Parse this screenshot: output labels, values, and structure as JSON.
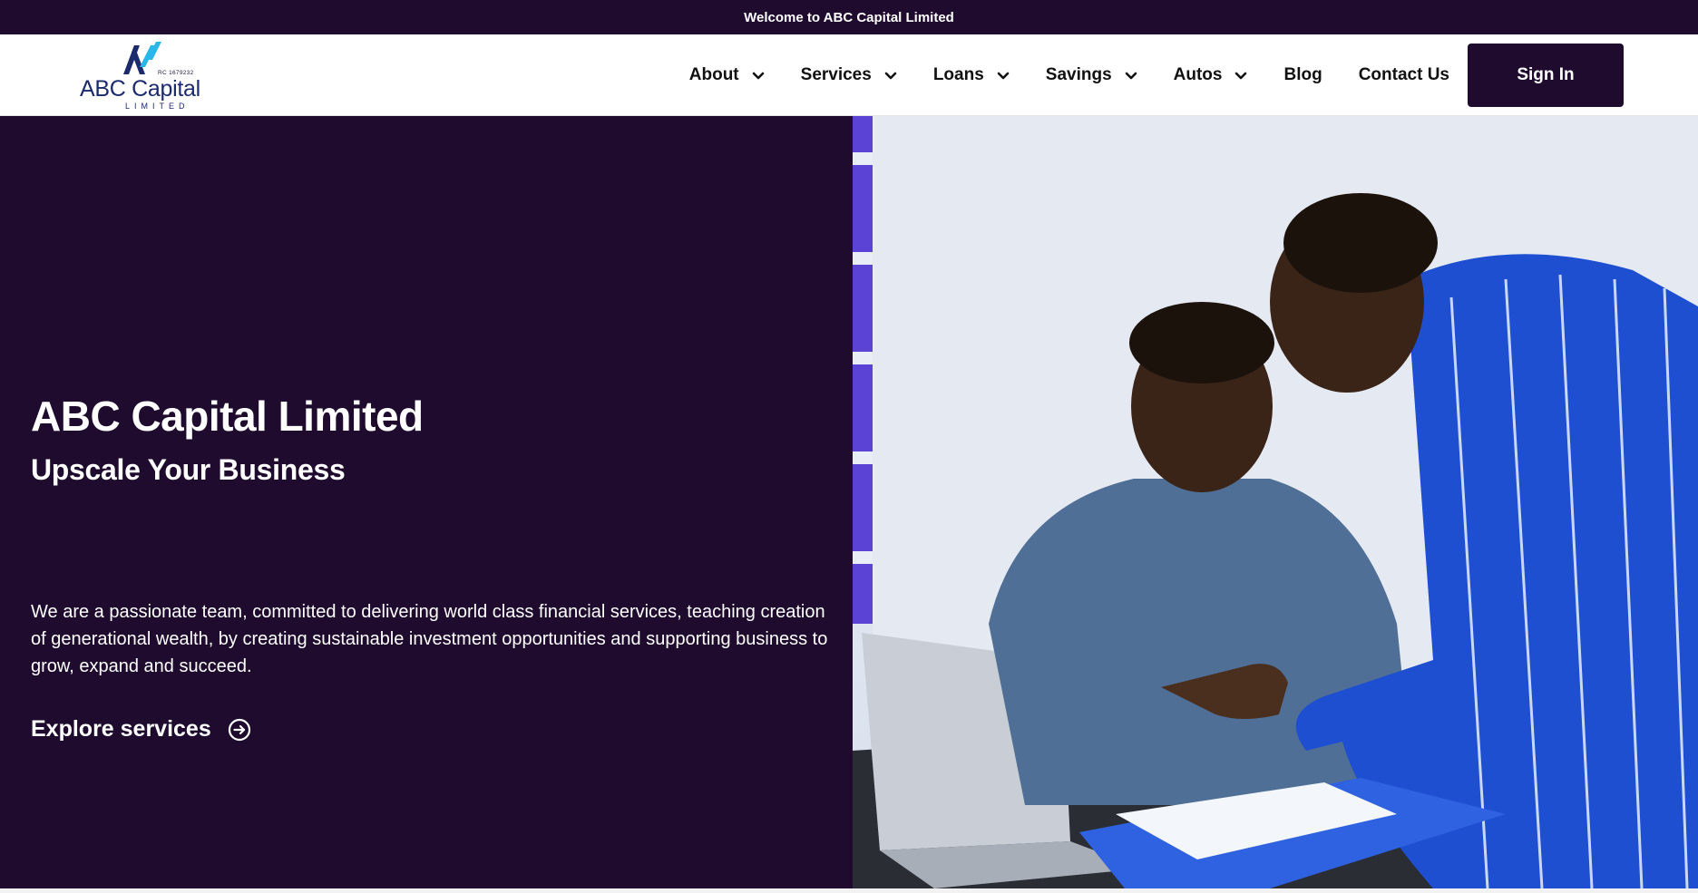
{
  "topbar": {
    "welcome": "Welcome to ABC Capital Limited"
  },
  "logo": {
    "registration": "RC 1679232",
    "name": "ABC Capital",
    "subtitle": "LIMITED"
  },
  "nav": {
    "items": [
      {
        "label": "About",
        "dropdown": true
      },
      {
        "label": "Services",
        "dropdown": true
      },
      {
        "label": "Loans",
        "dropdown": true
      },
      {
        "label": "Savings",
        "dropdown": true
      },
      {
        "label": "Autos",
        "dropdown": true
      },
      {
        "label": "Blog",
        "dropdown": false
      },
      {
        "label": "Contact Us",
        "dropdown": false
      }
    ],
    "signin_label": "Sign In"
  },
  "hero": {
    "title": "ABC Capital Limited",
    "subtitle": "Upscale Your Business",
    "description": "We are a passionate team, committed to delivering world class financial services, teaching creation of generational wealth, by creating sustainable investment opportunities and supporting business to grow, expand and succeed.",
    "cta_label": "Explore services",
    "cta_icon": "arrow-right-circle-icon"
  },
  "colors": {
    "brand_dark": "#1e0b2e",
    "logo_navy": "#1c2a6e",
    "logo_cyan": "#29b6e8",
    "photo_shirt_blue": "#1f4fd1"
  }
}
